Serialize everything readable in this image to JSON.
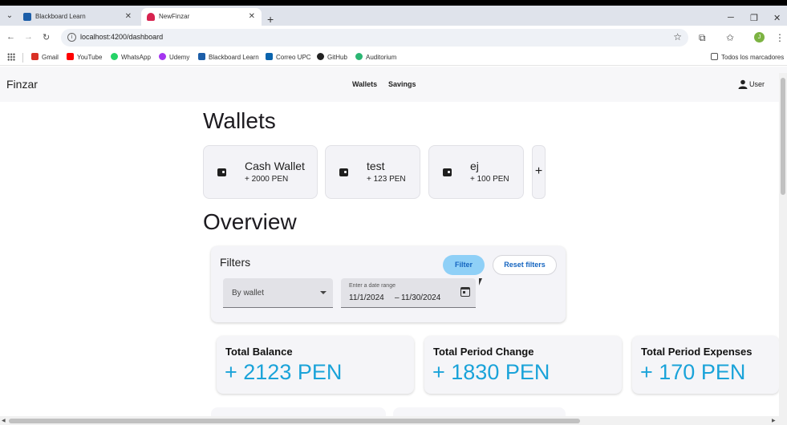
{
  "browser": {
    "tabs": [
      {
        "title": "Blackboard Learn",
        "favicon": "blackboard-favicon"
      },
      {
        "title": "NewFinzar",
        "favicon": "angular-favicon",
        "active": true
      }
    ],
    "url": "localhost:4200/dashboard",
    "profile_initial": "J",
    "bookmarks": [
      {
        "label": "Gmail",
        "icon": "gmail-icon",
        "color": "#d93025"
      },
      {
        "label": "YouTube",
        "icon": "youtube-icon",
        "color": "#ff0000"
      },
      {
        "label": "WhatsApp",
        "icon": "whatsapp-icon",
        "color": "#25d366"
      },
      {
        "label": "Udemy",
        "icon": "udemy-icon",
        "color": "#a435f0"
      },
      {
        "label": "Blackboard Learn",
        "icon": "blackboard-icon",
        "color": "#1c5ea8"
      },
      {
        "label": "Correo UPC",
        "icon": "outlook-icon",
        "color": "#0a64ad"
      },
      {
        "label": "GitHub",
        "icon": "github-icon",
        "color": "#222222"
      },
      {
        "label": "Auditorium",
        "icon": "auditorium-icon",
        "color": "#2bb673"
      }
    ],
    "all_bookmarks": "Todos los marcadores"
  },
  "app": {
    "brand": "Finzar",
    "nav": {
      "wallets": "Wallets",
      "savings": "Savings"
    },
    "user_label": "User"
  },
  "wallets": {
    "heading": "Wallets",
    "cards": [
      {
        "name": "Cash Wallet",
        "amount": "+ 2000 PEN"
      },
      {
        "name": "test",
        "amount": "+ 123 PEN"
      },
      {
        "name": "ej",
        "amount": "+ 100 PEN"
      }
    ],
    "add_label": "+"
  },
  "overview": {
    "heading": "Overview",
    "filters": {
      "title": "Filters",
      "filter_button": "Filter",
      "reset_button": "Reset filters",
      "wallet_select": "By wallet",
      "date_label": "Enter a date range",
      "date_start": "11/1/2024",
      "date_sep": "–",
      "date_end": "11/30/2024"
    },
    "stats": [
      {
        "label": "Total Balance",
        "value": "+ 2123 PEN"
      },
      {
        "label": "Total Period Change",
        "value": "+ 1830 PEN"
      },
      {
        "label": "Total Period Expenses",
        "value": "+ 170 PEN"
      }
    ]
  },
  "colors": {
    "accent": "#1aa3d9",
    "filter_button": "#8fd0f7",
    "link_text": "#1565c0"
  }
}
